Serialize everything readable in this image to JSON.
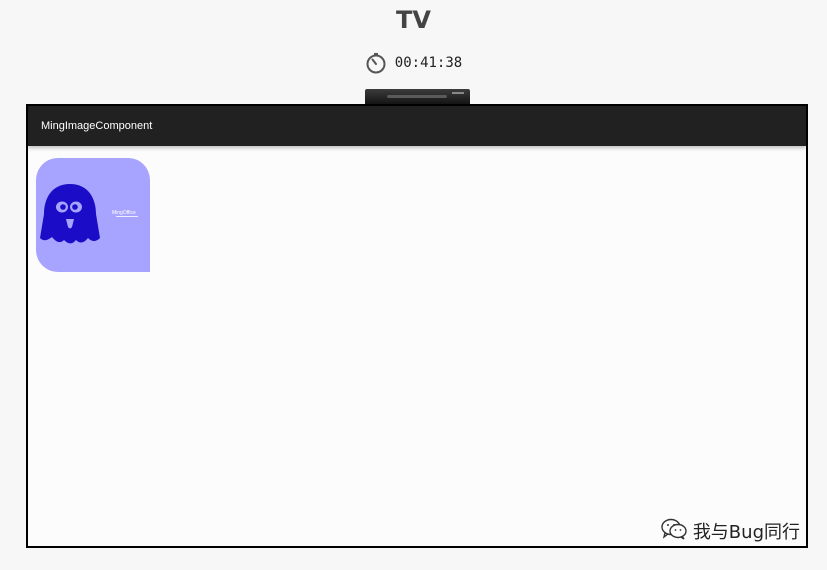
{
  "page": {
    "title": "TV",
    "timer": {
      "icon": "stopwatch-icon",
      "text": "00:41:38"
    }
  },
  "device": {
    "type": "tv",
    "app_bar": {
      "title": "MingImageComponent"
    },
    "image_card": {
      "icon": "ghost-icon",
      "background": "#a7a4ff",
      "ghost_color": "#1a0cc7",
      "caption": "MingOffice"
    }
  },
  "watermark": {
    "icon": "wechat-icon",
    "text": "我与Bug同行"
  },
  "colors": {
    "page_bg": "#f7f7f7",
    "app_bar_bg": "#212121",
    "screen_bg": "#fdfcfd"
  }
}
